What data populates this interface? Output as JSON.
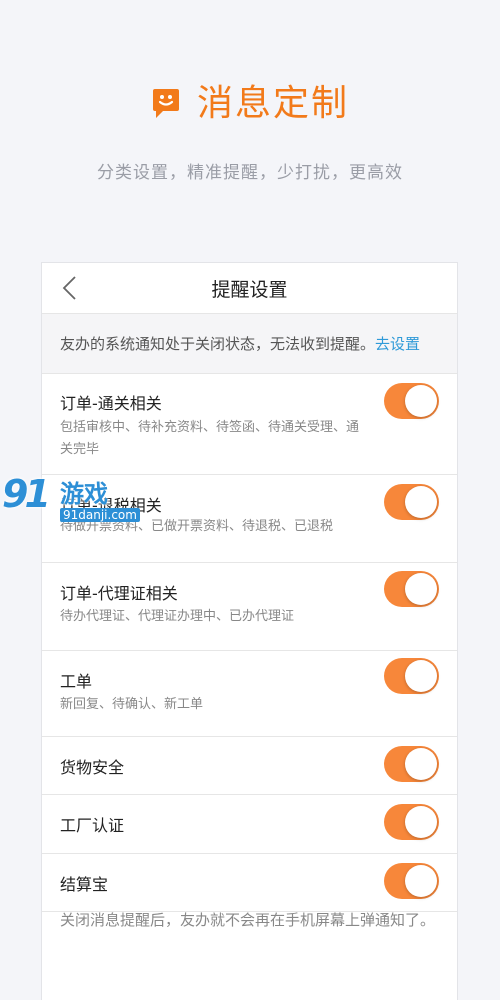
{
  "hero": {
    "title": "消息定制",
    "subtitle": "分类设置，精准提醒，少打扰，更高效"
  },
  "nav": {
    "title": "提醒设置"
  },
  "notice": {
    "text": "友办的系统通知处于关闭状态，无法收到提醒。",
    "link": "去设置"
  },
  "settings": [
    {
      "title": "订单-通关相关",
      "desc": "包括审核中、待补充资料、待签函、待通关受理、通关完毕",
      "enabled": true
    },
    {
      "title": "订单-退税相关",
      "desc": "待做开票资料、已做开票资料、待退税、已退税",
      "enabled": true
    },
    {
      "title": "订单-代理证相关",
      "desc": "待办代理证、代理证办理中、已办代理证",
      "enabled": true
    },
    {
      "title": "工单",
      "desc": "新回复、待确认、新工单",
      "enabled": true
    },
    {
      "title": "货物安全",
      "desc": "",
      "enabled": true
    },
    {
      "title": "工厂认证",
      "desc": "",
      "enabled": true
    },
    {
      "title": "结算宝",
      "desc": "",
      "enabled": true
    }
  ],
  "footer": {
    "note": "关闭消息提醒后，友办就不会再在手机屏幕上弹通知了。"
  },
  "watermark": {
    "logo": "91",
    "name": "游戏",
    "url": "91danji.com"
  },
  "colors": {
    "accent": "#f27a1a",
    "toggle_on": "#f7873a",
    "link": "#2f9ad8"
  },
  "icons": {
    "hero": "smiley-chat-icon",
    "back": "chevron-left-icon"
  }
}
